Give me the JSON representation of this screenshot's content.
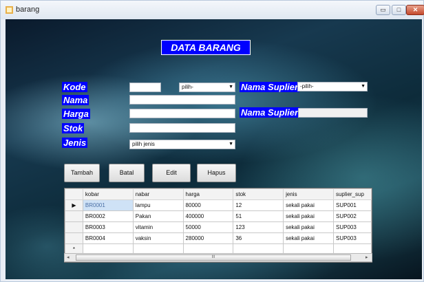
{
  "window": {
    "title": "barang",
    "minimize": "▭",
    "maximize": "□",
    "close": "✕"
  },
  "heading": "DATA BARANG",
  "labels": {
    "kode": "Kode",
    "nama": "Nama",
    "harga": "Harga",
    "stok": "Stok",
    "jenis": "Jenis",
    "nama_suplier_1": "Nama Suplier",
    "nama_suplier_2": "Nama Suplier"
  },
  "fields": {
    "kode": "",
    "pilih_combo": "pilih-",
    "nama": "",
    "harga": "",
    "stok": "",
    "jenis": "pilih jenis",
    "suplier_combo": "-pilih-",
    "suplier_name": ""
  },
  "buttons": {
    "tambah": "Tambah",
    "batal": "Batal",
    "edit": "Edit",
    "hapus": "Hapus"
  },
  "grid": {
    "columns": [
      "kobar",
      "nabar",
      "harga",
      "stok",
      "jenis",
      "suplier_sup"
    ],
    "current_marker": "▶",
    "new_marker": "*",
    "rows": [
      [
        "BR0001",
        "lampu",
        "80000",
        "12",
        "sekali pakai",
        "SUP001"
      ],
      [
        "BR0002",
        "Pakan",
        "400000",
        "51",
        "sekali pakai",
        "SUP002"
      ],
      [
        "BR0003",
        "vitamin",
        "50000",
        "123",
        "sekali pakai",
        "SUP003"
      ],
      [
        "BR0004",
        "vaksin",
        "280000",
        "36",
        "sekali pakai",
        "SUP003"
      ]
    ],
    "scroll_grip": "III"
  }
}
